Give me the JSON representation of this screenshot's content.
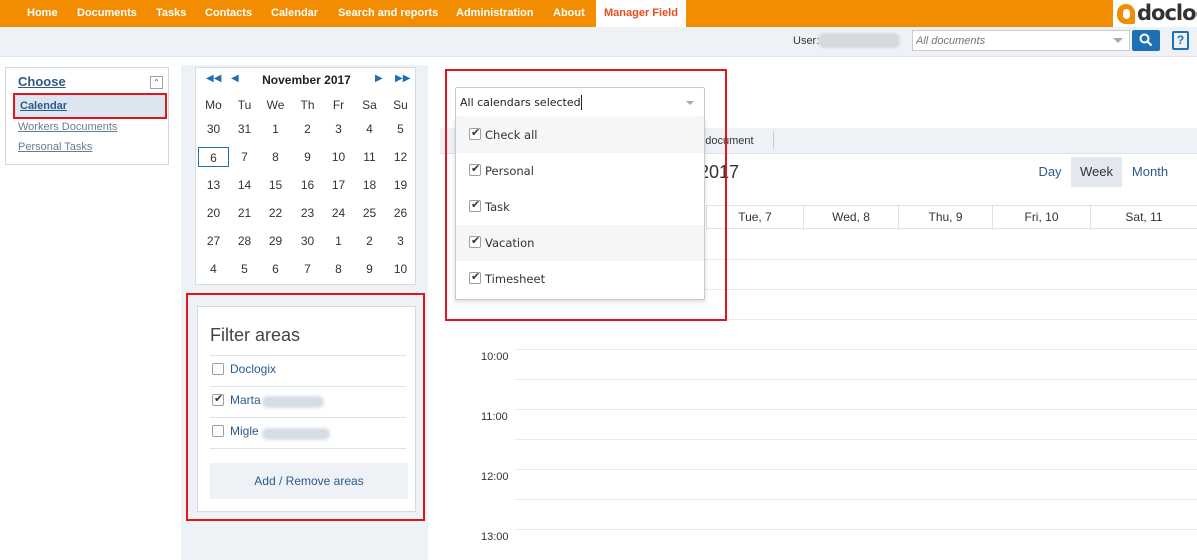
{
  "nav": {
    "items": [
      "Home",
      "Documents",
      "Tasks",
      "Contacts",
      "Calendar",
      "Search and reports",
      "Administration",
      "About",
      "Manager Field"
    ],
    "active": "Manager Field",
    "logo_text": "doclogix"
  },
  "userbar": {
    "user_label": "User:",
    "search_placeholder": "All documents",
    "help_label": "?"
  },
  "choose": {
    "title": "Choose",
    "links": [
      "Calendar",
      "Workers Documents",
      "Personal Tasks"
    ],
    "selected": "Calendar"
  },
  "mini_calendar": {
    "title": "November 2017",
    "dows": [
      "Mo",
      "Tu",
      "We",
      "Th",
      "Fr",
      "Sa",
      "Su"
    ],
    "weeks": [
      [
        "30",
        "31",
        "1",
        "2",
        "3",
        "4",
        "5"
      ],
      [
        "6",
        "7",
        "8",
        "9",
        "10",
        "11",
        "12"
      ],
      [
        "13",
        "14",
        "15",
        "16",
        "17",
        "18",
        "19"
      ],
      [
        "20",
        "21",
        "22",
        "23",
        "24",
        "25",
        "26"
      ],
      [
        "27",
        "28",
        "29",
        "30",
        "1",
        "2",
        "3"
      ],
      [
        "4",
        "5",
        "6",
        "7",
        "8",
        "9",
        "10"
      ]
    ],
    "today": "6"
  },
  "filter_areas": {
    "title": "Filter areas",
    "items": [
      {
        "label": "Doclogix",
        "checked": false
      },
      {
        "label": "Marta",
        "checked": true
      },
      {
        "label": "Migle",
        "checked": false
      }
    ],
    "button": "Add / Remove areas"
  },
  "calendar_select": {
    "value": "All calendars selected",
    "options": [
      {
        "label": "Check all",
        "checked": true
      },
      {
        "label": "Personal",
        "checked": true
      },
      {
        "label": "Task",
        "checked": true
      },
      {
        "label": "Vacation",
        "checked": true
      },
      {
        "label": "Timesheet",
        "checked": true
      }
    ]
  },
  "main": {
    "toolbar_text": "et document",
    "range_title": "2017",
    "views": [
      "Day",
      "Week",
      "Month"
    ],
    "active_view": "Week",
    "day_headers": [
      "Tue, 7",
      "Wed, 8",
      "Thu, 9",
      "Fri, 10",
      "Sat, 11"
    ],
    "times": [
      "10:00",
      "11:00",
      "12:00",
      "13:00"
    ]
  }
}
